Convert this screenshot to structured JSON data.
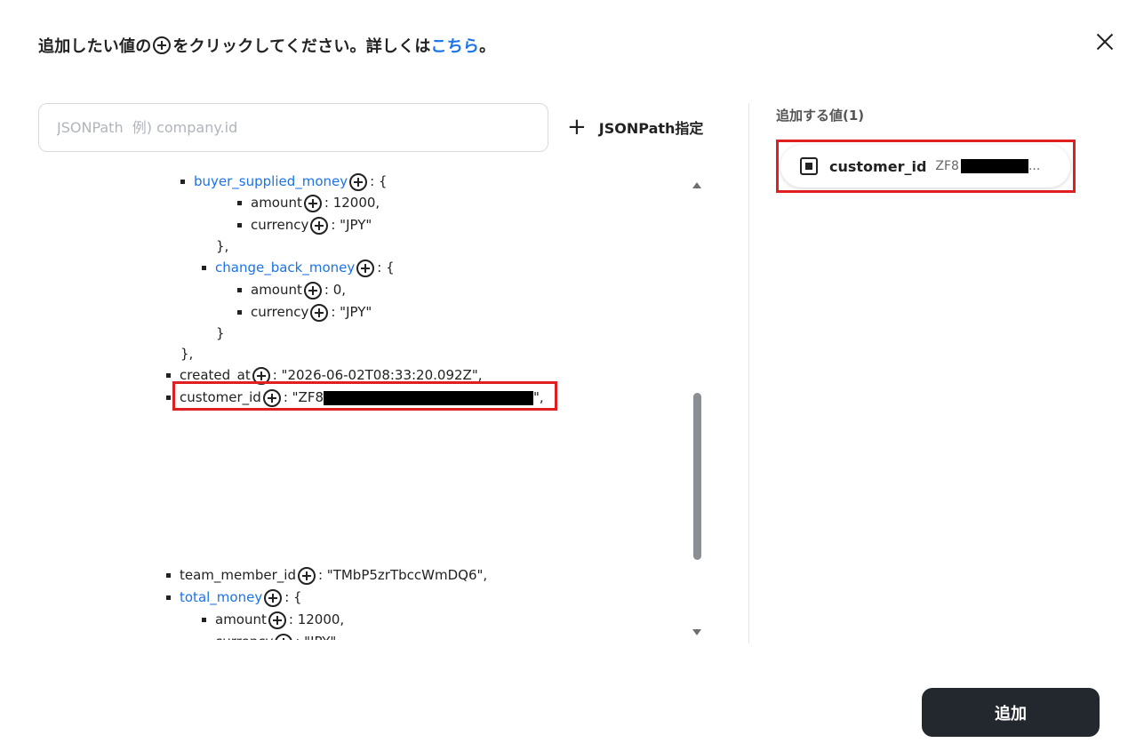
{
  "header": {
    "instruction_before": "追加したい値の",
    "instruction_after": "をクリックしてください。詳しくは",
    "link_text": "こちら",
    "period": "。"
  },
  "search": {
    "placeholder": "JSONPath  例) company.id"
  },
  "jsonpath_button": {
    "icon": "+",
    "label": "JSONPath指定"
  },
  "tree": {
    "rows": [
      {
        "key": "buyer_supplied_money",
        "suffix": ": {"
      },
      {
        "key": "amount",
        "suffix": ": 12000,"
      },
      {
        "key": "currency",
        "suffix": ": \"JPY\""
      },
      {
        "text": "},"
      },
      {
        "key": "change_back_money",
        "suffix": ": {"
      },
      {
        "key": "amount",
        "suffix": ": 0,"
      },
      {
        "key": "currency",
        "suffix": ": \"JPY\""
      },
      {
        "text": "}"
      },
      {
        "text": "},"
      },
      {
        "key": "created_at",
        "suffix": ": \"2026-06-02T08:33:20.092Z\","
      },
      {
        "key": "customer_id",
        "prefix_value": ": \"ZF8",
        "suffix": "\","
      },
      {
        "key": "team_member_id",
        "suffix": ": \"TMbP5zrTbccWmDQ6\","
      },
      {
        "key": "total_money",
        "suffix": ": {"
      },
      {
        "key": "amount",
        "suffix": ": 12000,"
      },
      {
        "key": "currency",
        "suffix": ": \"JPY\""
      }
    ]
  },
  "right_panel": {
    "title": "追加する値(1)",
    "chip": {
      "icon": "square-dot-icon",
      "label": "customer_id",
      "value_prefix": "ZF8",
      "value_suffix": "..."
    }
  },
  "footer": {
    "add_label": "追加"
  },
  "colors": {
    "link": "#1a73e8",
    "highlight": "#e02020",
    "primary_button": "#23272e"
  }
}
